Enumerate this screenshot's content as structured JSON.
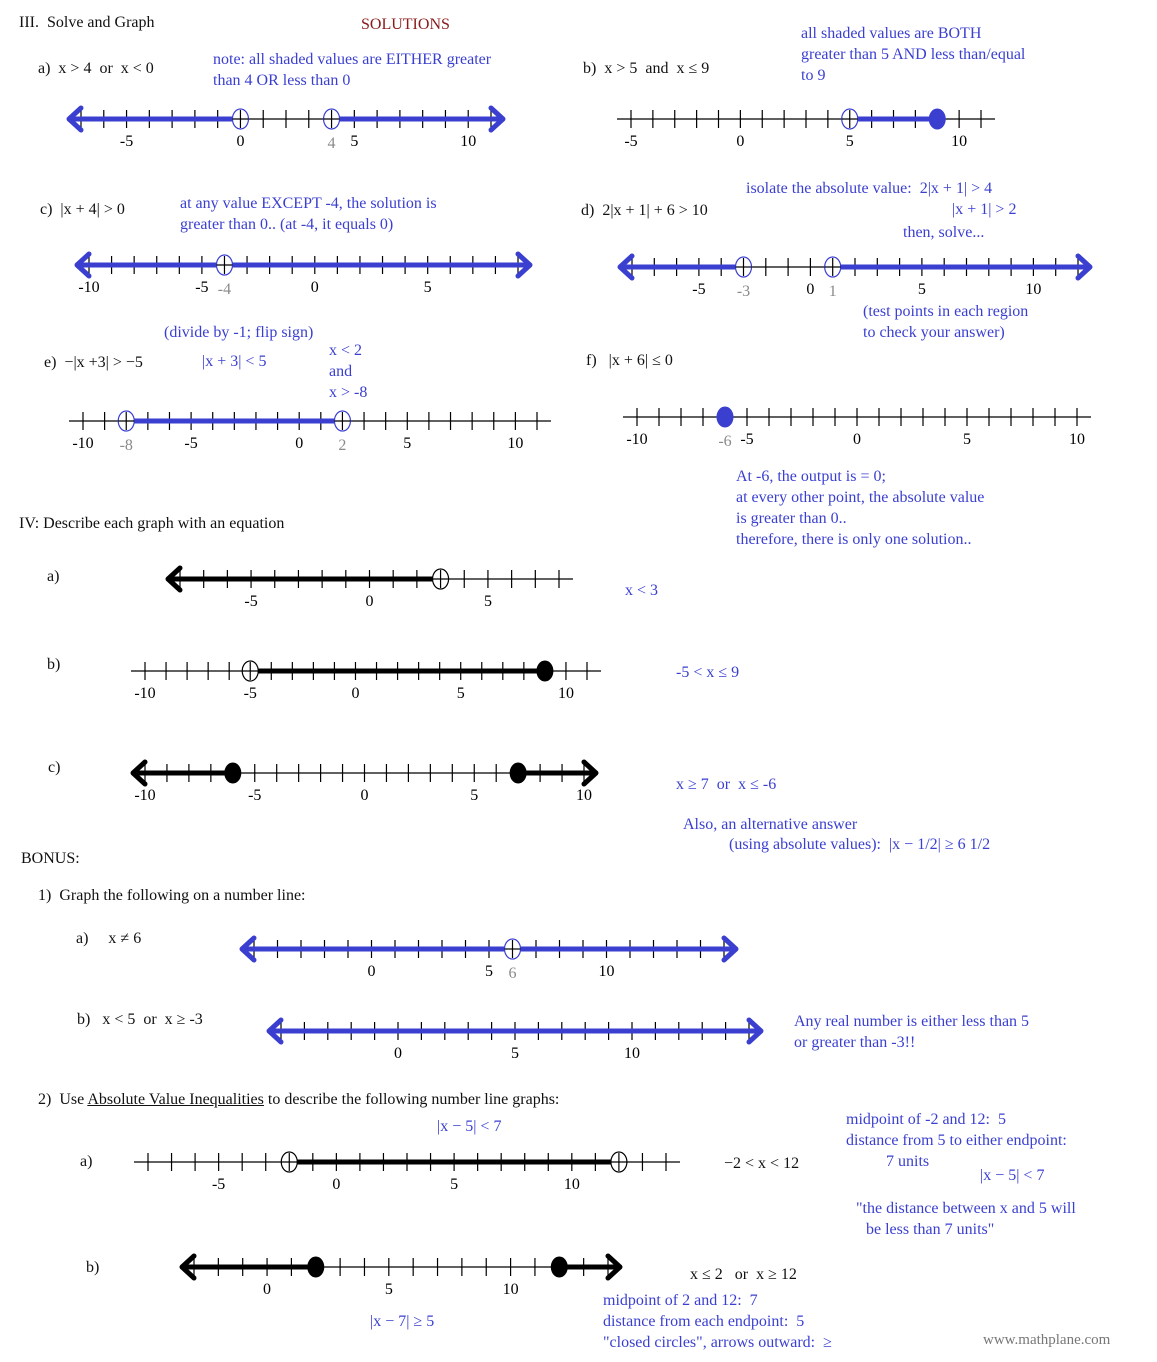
{
  "colors": {
    "blue": "#3a3fd0",
    "black": "#000000",
    "gray": "#8a8a8a",
    "title_red": "#8b1a1a"
  },
  "header": {
    "section3_title": "III.  Solve and Graph",
    "solutions_label": "SOLUTIONS"
  },
  "part3": {
    "a": {
      "label": "a)  x > 4  or  x < 0",
      "note": [
        "note: all shaded values are EITHER greater",
        "than 4 OR less than 0"
      ]
    },
    "b": {
      "label": "b)  x > 5  and  x ≤ 9",
      "note": [
        "all shaded values are BOTH",
        "greater than 5 AND less than/equal",
        "to 9"
      ]
    },
    "c": {
      "label": "c)  |x + 4| > 0",
      "note": [
        "at any value EXCEPT -4, the solution is",
        "greater than 0.. (at -4, it equals 0)"
      ]
    },
    "d": {
      "label": "d)  2|x + 1| + 6 > 10",
      "note": [
        "isolate the absolute value:  2|x + 1| > 4",
        "|x + 1| > 2",
        "then, solve..."
      ],
      "test_note": [
        "(test points in each region",
        "to check your answer)"
      ]
    },
    "e": {
      "label": "e)  −|x +3| > −5",
      "step1": "(divide by -1; flip sign)",
      "step2": "|x + 3| < 5",
      "step3": [
        "x < 2",
        "and",
        "x > -8"
      ]
    },
    "f": {
      "label": "f)   |x + 6| ≤ 0",
      "note": [
        "At -6, the output is = 0;",
        "at every other point, the absolute value",
        "is greater than 0..",
        "therefore, there is only one solution.."
      ]
    }
  },
  "part4": {
    "title": "IV: Describe each graph with an equation",
    "a": {
      "label": "a)",
      "answer": "x < 3"
    },
    "b": {
      "label": "b)",
      "answer": "-5 < x ≤ 9"
    },
    "c": {
      "label": "c)",
      "answer": "x ≥ 7  or  x ≤ -6",
      "alt": [
        "Also, an alternative answer",
        "(using absolute values):  |x − 1/2| ≥ 6 1/2"
      ]
    }
  },
  "bonus": {
    "title": "BONUS:",
    "q1": {
      "prompt": "1)  Graph the following on a number line:",
      "a": {
        "label": "a)     x ≠ 6"
      },
      "b": {
        "label": "b)   x < 5  or  x ≥ -3",
        "note": [
          "Any real number is either less than 5",
          "or greater than -3!!"
        ]
      }
    },
    "q2": {
      "prompt_num": "2)  Use ",
      "prompt_link": "Absolute Value Inequalities",
      "prompt_rest": " to describe the following number line graphs:",
      "a": {
        "label": "a)",
        "above": "|x − 5| < 7",
        "answer": "−2 < x < 12",
        "note": [
          "midpoint of -2 and 12:  5",
          "distance from 5 to either endpoint:",
          "7 units",
          "|x − 5| < 7",
          "\"the distance between x and 5 will",
          "be less than 7 units\""
        ]
      },
      "b": {
        "label": "b)",
        "below": "|x − 7| ≥ 5",
        "answer": "x ≤ 2   or  x ≥ 12",
        "note": [
          "midpoint of 2 and 12:  7",
          "distance from each endpoint:  5",
          "\"closed circles\", arrows outward:  ≥"
        ]
      }
    }
  },
  "watermark": "www.mathplane.com",
  "number_lines": {
    "p3a": {
      "min": -7,
      "max": 11,
      "labels": [
        -5,
        0,
        5,
        10
      ],
      "color": "blue",
      "segments": [
        {
          "from": "-inf",
          "to": 0
        },
        {
          "from": 4,
          "to": "inf"
        }
      ],
      "points": [
        {
          "x": 0,
          "closed": false
        },
        {
          "x": 4,
          "closed": false
        }
      ],
      "extra_labels": [
        {
          "x": 4,
          "text": "4"
        }
      ]
    },
    "p3b": {
      "min": -5,
      "max": 11,
      "labels": [
        -5,
        0,
        5,
        10
      ],
      "color": "blue",
      "segments": [
        {
          "from": 5,
          "to": 9
        }
      ],
      "points": [
        {
          "x": 5,
          "closed": false
        },
        {
          "x": 9,
          "closed": true
        }
      ],
      "extra_labels": []
    },
    "p3c": {
      "min": -10,
      "max": 9,
      "labels": [
        -10,
        -5,
        0,
        5
      ],
      "color": "blue",
      "segments": [
        {
          "from": "-inf",
          "to": -4
        },
        {
          "from": -4,
          "to": "inf"
        }
      ],
      "points": [
        {
          "x": -4,
          "closed": false
        }
      ],
      "extra_labels": [
        {
          "x": -4,
          "text": "-4"
        }
      ]
    },
    "p3d": {
      "min": -8,
      "max": 12,
      "labels": [
        -5,
        0,
        5,
        10
      ],
      "color": "blue",
      "segments": [
        {
          "from": "-inf",
          "to": -3
        },
        {
          "from": 1,
          "to": "inf"
        }
      ],
      "points": [
        {
          "x": -3,
          "closed": false
        },
        {
          "x": 1,
          "closed": false
        }
      ],
      "extra_labels": [
        {
          "x": -3,
          "text": "-3"
        },
        {
          "x": 1,
          "text": "1"
        }
      ]
    },
    "p3e": {
      "min": -10,
      "max": 11,
      "labels": [
        -10,
        -5,
        0,
        5,
        10
      ],
      "color": "blue",
      "segments": [
        {
          "from": -8,
          "to": 2
        }
      ],
      "points": [
        {
          "x": -8,
          "closed": false
        },
        {
          "x": 2,
          "closed": false
        }
      ],
      "extra_labels": [
        {
          "x": -8,
          "text": "-8"
        },
        {
          "x": 2,
          "text": "2"
        }
      ]
    },
    "p3f": {
      "min": -10,
      "max": 10,
      "labels": [
        -10,
        -5,
        0,
        5,
        10
      ],
      "color": "blue",
      "segments": [],
      "points": [
        {
          "x": -6,
          "closed": true
        }
      ],
      "extra_labels": [
        {
          "x": -6,
          "text": "-6"
        }
      ]
    },
    "p4a": {
      "min": -8,
      "max": 8,
      "labels": [
        -5,
        0,
        5
      ],
      "color": "black",
      "segments": [
        {
          "from": "-inf",
          "to": 3
        }
      ],
      "points": [
        {
          "x": 3,
          "closed": false
        }
      ],
      "extra_labels": []
    },
    "p4b": {
      "min": -10,
      "max": 11,
      "labels": [
        -10,
        -5,
        0,
        5,
        10
      ],
      "color": "black",
      "segments": [
        {
          "from": -5,
          "to": 9
        }
      ],
      "points": [
        {
          "x": -5,
          "closed": false
        },
        {
          "x": 9,
          "closed": true
        }
      ],
      "extra_labels": []
    },
    "p4c": {
      "min": -10,
      "max": 10,
      "labels": [
        -10,
        -5,
        0,
        5,
        10
      ],
      "color": "black",
      "segments": [
        {
          "from": "-inf",
          "to": -6
        },
        {
          "from": 7,
          "to": "inf"
        }
      ],
      "points": [
        {
          "x": -6,
          "closed": true
        },
        {
          "x": 7,
          "closed": true
        }
      ],
      "extra_labels": []
    },
    "b1a": {
      "min": -5,
      "max": 15,
      "labels": [
        0,
        5,
        10
      ],
      "color": "blue",
      "segments": [
        {
          "from": "-inf",
          "to": 6
        },
        {
          "from": 6,
          "to": "inf"
        }
      ],
      "points": [
        {
          "x": 6,
          "closed": false
        }
      ],
      "extra_labels": [
        {
          "x": 6,
          "text": "6"
        }
      ]
    },
    "b1b": {
      "min": -5,
      "max": 15,
      "labels": [
        0,
        5,
        10
      ],
      "color": "blue",
      "segments": [
        {
          "from": "-inf",
          "to": "inf"
        }
      ],
      "points": [],
      "extra_labels": []
    },
    "b2a": {
      "min": -8,
      "max": 14,
      "labels": [
        -5,
        0,
        5,
        10
      ],
      "color": "black",
      "segments": [
        {
          "from": -2,
          "to": 12
        }
      ],
      "points": [
        {
          "x": -2,
          "closed": false
        },
        {
          "x": 12,
          "closed": false
        }
      ],
      "extra_labels": []
    },
    "b2b": {
      "min": -3,
      "max": 14,
      "labels": [
        0,
        5,
        10
      ],
      "color": "black",
      "segments": [
        {
          "from": "-inf",
          "to": 2
        },
        {
          "from": 12,
          "to": "inf"
        }
      ],
      "points": [
        {
          "x": 2,
          "closed": true
        },
        {
          "x": 12,
          "closed": true
        }
      ],
      "extra_labels": []
    }
  }
}
